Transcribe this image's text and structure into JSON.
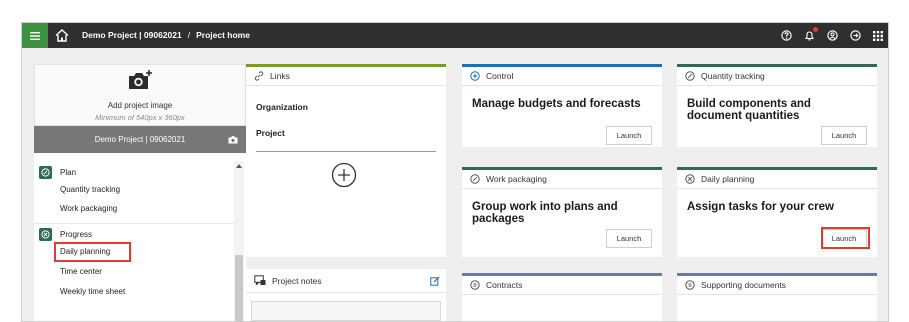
{
  "header": {
    "project": "Demo Project | 09062021",
    "separator": "/",
    "page": "Project home"
  },
  "icons": {
    "menu": "hamburger-icon",
    "home": "home-icon",
    "help": "help-icon",
    "notifications": "bell-icon",
    "user": "user-icon",
    "logout": "logout-icon",
    "apps": "grid-icon"
  },
  "colors": {
    "accent_green": "#3f9142",
    "topbar": "#2f2f2f",
    "card_green": "#7a9a2f",
    "card_blue": "#1f6fb5",
    "card_dark_green": "#2e6b4f",
    "card_slate": "#6b7d9e",
    "highlight_red": "#e03c31"
  },
  "sidebar": {
    "add_image": "Add project image",
    "min_size": "Minimum of 540px x 360px",
    "project_name": "Demo Project | 09062021",
    "groups": [
      {
        "title": "Plan",
        "items": [
          "Quantity tracking",
          "Work packaging"
        ]
      },
      {
        "title": "Progress",
        "items": [
          "Daily planning",
          "Time center",
          "Weekly time sheet"
        ]
      }
    ]
  },
  "cards": {
    "links": {
      "header": "Links",
      "organization": "Organization",
      "project": "Project"
    },
    "control": {
      "header": "Control",
      "title": "Manage budgets and forecasts",
      "launch": "Launch"
    },
    "quantity": {
      "header": "Quantity tracking",
      "title": "Build components and document quantities",
      "launch": "Launch"
    },
    "work_packaging": {
      "header": "Work packaging",
      "title": "Group work into plans and packages",
      "launch": "Launch"
    },
    "daily_planning": {
      "header": "Daily planning",
      "title": "Assign tasks for your crew",
      "launch": "Launch"
    },
    "notes": {
      "header": "Project notes"
    },
    "contracts": {
      "header": "Contracts"
    },
    "supporting": {
      "header": "Supporting documents"
    }
  }
}
